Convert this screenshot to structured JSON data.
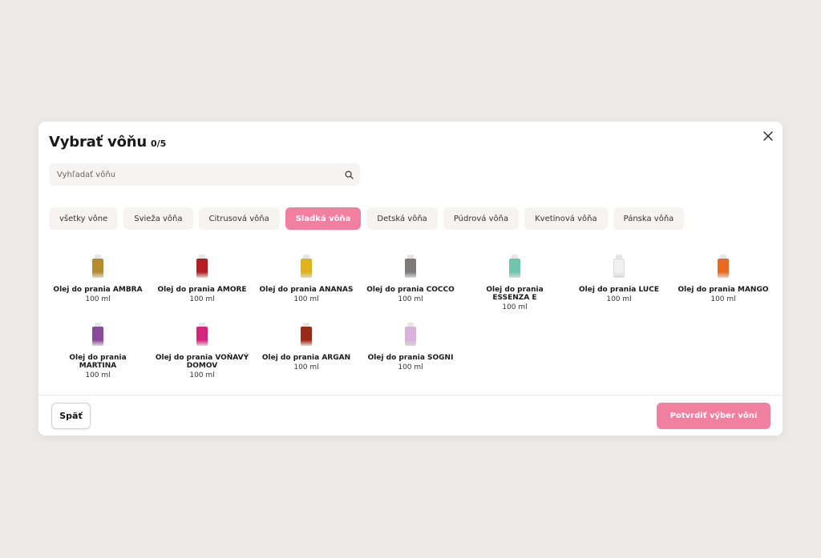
{
  "modal": {
    "title": "Vybrať vôňu",
    "count": "0/5",
    "close_icon": "close-icon"
  },
  "search": {
    "placeholder": "Vyhľadať vôňu",
    "value": "",
    "icon": "search-icon"
  },
  "filters": [
    {
      "label": "všetky vône",
      "active": false
    },
    {
      "label": "Svieža vôňa",
      "active": false
    },
    {
      "label": "Citrusová vôňa",
      "active": false
    },
    {
      "label": "Sladká vôňa",
      "active": true
    },
    {
      "label": "Detská vôňa",
      "active": false
    },
    {
      "label": "Púdrová vôňa",
      "active": false
    },
    {
      "label": "Kvetinová vôňa",
      "active": false
    },
    {
      "label": "Pánska vôňa",
      "active": false
    }
  ],
  "products": [
    {
      "name": "Olej do prania AMBRA",
      "size": "100 ml",
      "color": "#b88a2e"
    },
    {
      "name": "Olej do prania AMORE",
      "size": "100 ml",
      "color": "#b81c22"
    },
    {
      "name": "Olej do prania ANANAS",
      "size": "100 ml",
      "color": "#e0b21c"
    },
    {
      "name": "Olej do prania COCCO",
      "size": "100 ml",
      "color": "#7d7a7a"
    },
    {
      "name": "Olej do prania ESSENZA E",
      "size": "100 ml",
      "color": "#6fc6ac"
    },
    {
      "name": "Olej do prania LUCE",
      "size": "100 ml",
      "color": "#f0f0f0"
    },
    {
      "name": "Olej do prania MANGO",
      "size": "100 ml",
      "color": "#e86a1e"
    },
    {
      "name": "Olej do prania MARTINA",
      "size": "100 ml",
      "color": "#8a4a9a"
    },
    {
      "name": "Olej do prania VOŇAVÝ DOMOV",
      "size": "100 ml",
      "color": "#d6247c"
    },
    {
      "name": "Olej do prania ARGAN",
      "size": "100 ml",
      "color": "#9a2a18"
    },
    {
      "name": "Olej do prania SOGNI",
      "size": "100 ml",
      "color": "#d9b2dc"
    }
  ],
  "footer": {
    "back_label": "Späť",
    "confirm_label": "Potvrdiť výber vôní"
  },
  "colors": {
    "accent": "#f07fa0",
    "backdrop": "#ebeae6",
    "chip_bg": "#f5f4f2"
  }
}
